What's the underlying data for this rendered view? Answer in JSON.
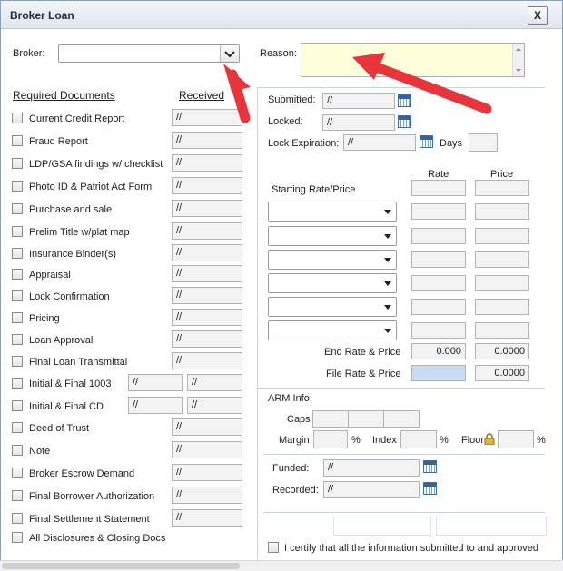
{
  "window": {
    "title": "Broker Loan",
    "close_label": "X"
  },
  "broker": {
    "label": "Broker:",
    "value": ""
  },
  "reason": {
    "label": "Reason:",
    "value": ""
  },
  "docs": {
    "header_required": "Required Documents",
    "header_received": "Received",
    "items": [
      {
        "label": "Current Credit Report",
        "received": "//"
      },
      {
        "label": "Fraud Report",
        "received": "//"
      },
      {
        "label": "LDP/GSA findings w/ checklist",
        "received": "//"
      },
      {
        "label": "Photo ID & Patriot Act Form",
        "received": "//"
      },
      {
        "label": "Purchase and sale",
        "received": "//"
      },
      {
        "label": "Prelim Title w/plat map",
        "received": "//"
      },
      {
        "label": "Insurance Binder(s)",
        "received": "//"
      },
      {
        "label": "Appraisal",
        "received": "//"
      },
      {
        "label": "Lock Confirmation",
        "received": "//"
      },
      {
        "label": "Pricing",
        "received": "//"
      },
      {
        "label": "Loan Approval",
        "received": "//"
      },
      {
        "label": "Final Loan Transmittal",
        "received": "//"
      },
      {
        "label": "Initial & Final 1003",
        "date1": "//",
        "date2": "//"
      },
      {
        "label": "Initial & Final CD",
        "date1": "//",
        "date2": "//"
      },
      {
        "label": "Deed of Trust",
        "received": "//"
      },
      {
        "label": "Note",
        "received": "//"
      },
      {
        "label": "Broker Escrow Demand",
        "received": "//"
      },
      {
        "label": "Final Borrower Authorization",
        "received": "//"
      },
      {
        "label": "Final Settlement Statement",
        "received": "//"
      },
      {
        "label": "All Disclosures & Closing Docs"
      }
    ]
  },
  "lock": {
    "submitted_label": "Submitted:",
    "submitted_value": "//",
    "locked_label": "Locked:",
    "locked_value": "//",
    "expiration_label": "Lock Expiration:",
    "expiration_value": "//",
    "days_label": "Days",
    "days_value": ""
  },
  "pricing": {
    "rate_header": "Rate",
    "price_header": "Price",
    "starting_label": "Starting Rate/Price",
    "end_label": "End Rate & Price",
    "end_rate": "0.000",
    "end_price": "0.0000",
    "file_label": "File Rate & Price",
    "file_rate": "",
    "file_price": "0.0000"
  },
  "arm": {
    "title": "ARM Info:",
    "caps_label": "Caps",
    "margin_label": "Margin",
    "index_label": "Index",
    "floor_label": "Floor",
    "pct": "%"
  },
  "funding": {
    "funded_label": "Funded:",
    "funded_value": "//",
    "recorded_label": "Recorded:",
    "recorded_value": "//"
  },
  "certify": {
    "label": "I certify that all the information submitted to and approved"
  },
  "colors": {
    "reason_bg": "#ffffdc",
    "file_rate_bg": "#c9dcf2",
    "annotation_arrow": "#e8353b"
  }
}
